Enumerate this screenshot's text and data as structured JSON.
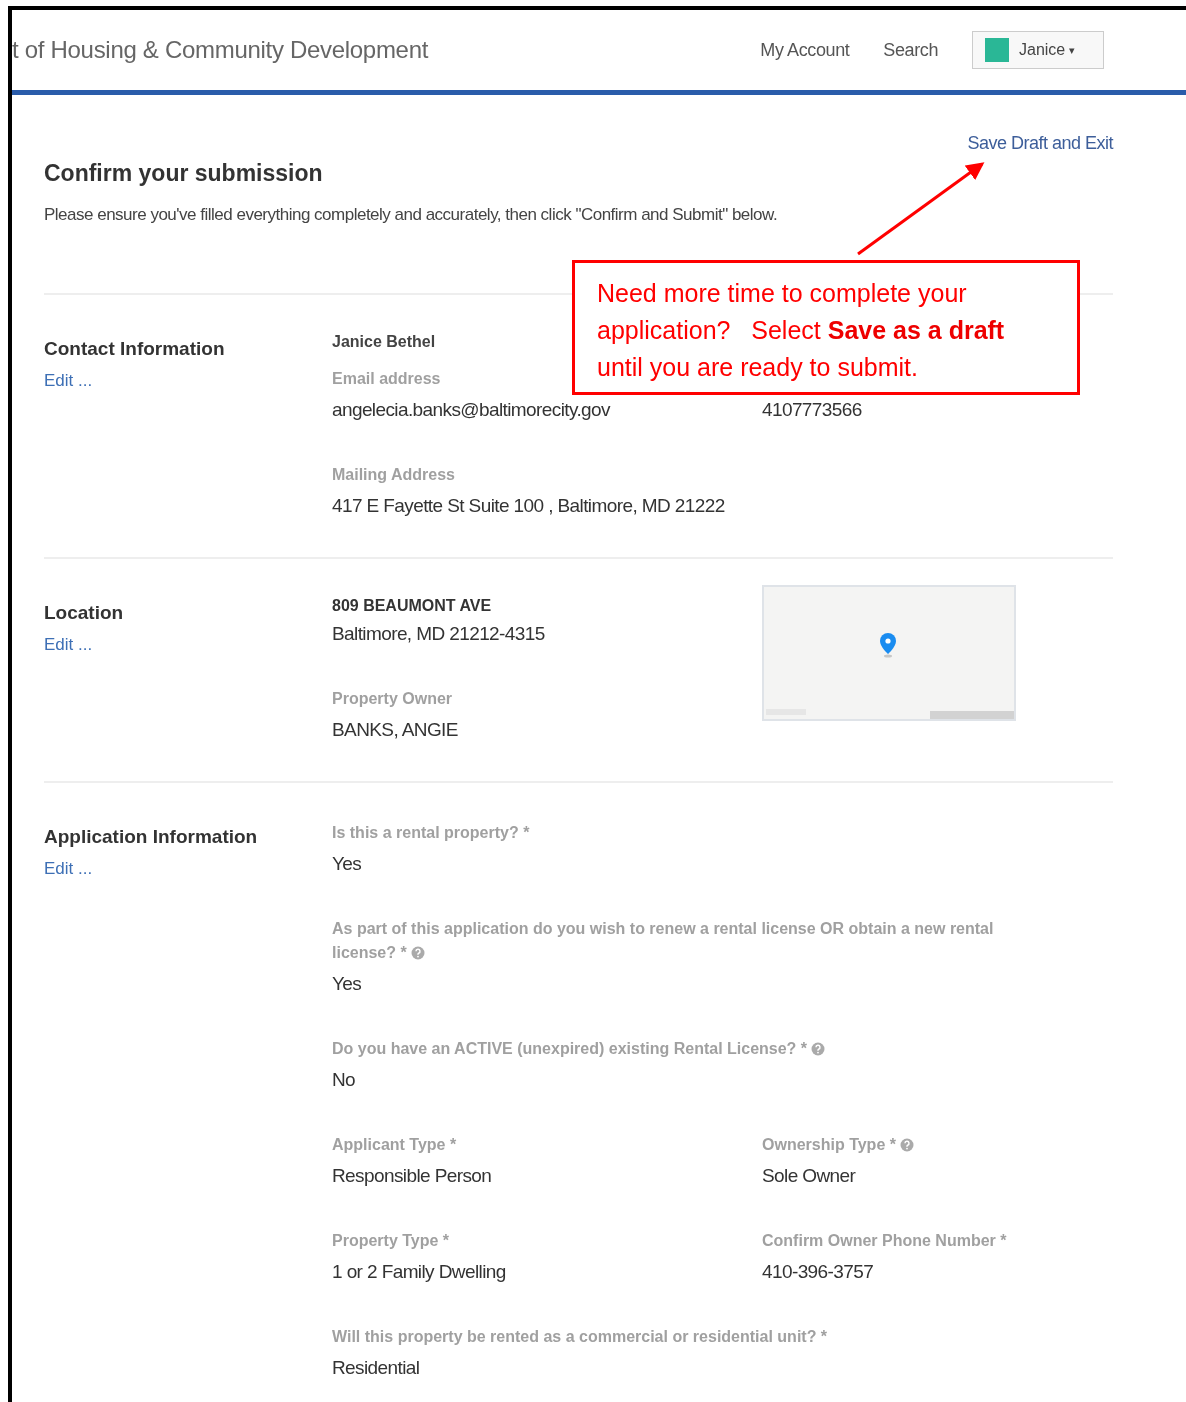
{
  "header": {
    "title": "t of Housing & Community Development",
    "nav": [
      "My Account",
      "Search"
    ],
    "user": {
      "name": "Janice",
      "caret": "▾"
    }
  },
  "save_link": "Save Draft and Exit",
  "heading": "Confirm your submission",
  "instructions": "Please ensure you've filled everything completely and accurately, then click \"Confirm and Submit\" below.",
  "sections": [
    {
      "title": "Contact Information",
      "edit": "Edit ...",
      "rows": [
        [
          {
            "kind": "name",
            "value": "Janice Bethel"
          }
        ],
        [
          {
            "kind": "field",
            "label": "Email address",
            "value": "angelecia.banks@baltimorecity.gov",
            "help": false
          },
          {
            "kind": "field",
            "value": "4107773566",
            "help": false
          }
        ],
        [
          {
            "kind": "field",
            "label": "Mailing Address",
            "value": "417 E Fayette St Suite 100 , Baltimore, MD 21222",
            "help": false
          }
        ]
      ]
    },
    {
      "title": "Location",
      "edit": "Edit ...",
      "map": {
        "kind": "picture"
      },
      "rows": [
        [
          {
            "kind": "address",
            "value": "809 BEAUMONT AVE",
            "value_2": "Baltimore, MD 21212-4315"
          }
        ],
        [
          {
            "kind": "field",
            "label": "Property Owner",
            "value": "BANKS, ANGIE",
            "help": false
          }
        ]
      ]
    },
    {
      "title": "Application Information",
      "edit": "Edit ...",
      "rows": [
        [
          {
            "kind": "field",
            "label": "Is this a rental property? *",
            "value": "Yes",
            "help": false
          }
        ],
        [
          {
            "kind": "field",
            "label": "As part of this application do you wish to renew a rental license OR obtain a new rental license? *",
            "value": "Yes",
            "help": true
          }
        ],
        [
          {
            "kind": "field",
            "label": "Do you have an ACTIVE (unexpired) existing Rental License? *",
            "value": "No",
            "help": true
          }
        ],
        [
          {
            "kind": "field",
            "label": "Applicant Type *",
            "value": "Responsible Person",
            "help": false
          },
          {
            "kind": "field",
            "label": "Ownership Type *",
            "value": "Sole Owner",
            "help": true
          }
        ],
        [
          {
            "kind": "field",
            "label": "Property Type *",
            "value": "1 or 2 Family Dwelling",
            "help": false
          },
          {
            "kind": "field",
            "label": "Confirm Owner Phone Number *",
            "value": "410-396-3757",
            "help": false
          }
        ],
        [
          {
            "kind": "field",
            "label": "Will this property be rented as a commercial or residential unit? *",
            "value": "Residential",
            "help": false
          }
        ]
      ]
    }
  ],
  "callout": {
    "lines": [
      "Need more time to complete your",
      "application?   Select **Save as a draft**",
      "until you are ready to submit."
    ]
  }
}
